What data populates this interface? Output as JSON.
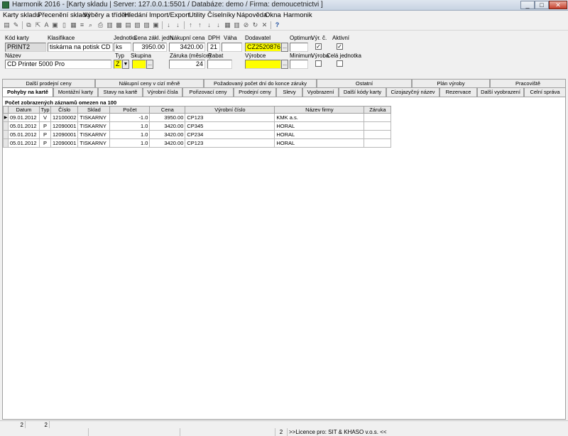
{
  "window": {
    "title": "Harmonik 2016 - [Karty skladu | Server: 127.0.0.1:5501 / Databáze: demo / Firma: demoucetnictvi ]",
    "min": "_",
    "max": "□",
    "close": "✕"
  },
  "menu": [
    "Karty skladu",
    "Přecenění skladu",
    "Výběry a třídění",
    "Hledání",
    "Import/Export",
    "Utility",
    "Číselníky",
    "Nápověda",
    "Okna",
    "Harmonik"
  ],
  "form": {
    "labels": {
      "kod_karty": "Kód karty",
      "klasifikace": "Klasifikace",
      "jednotka": "Jednotka",
      "cena_zakl": "Cena zákl. jedn.",
      "nakupni_cena": "Nákupní cena",
      "dph": "DPH",
      "vaha": "Váha",
      "dodavatel": "Dodavatel",
      "optimum": "Optimum",
      "vyr_c": "Výr. č.",
      "aktivni": "Aktivní",
      "nazev": "Název",
      "typ": "Typ",
      "skupina": "Skupina",
      "zaruka": "Záruka (měsíce)",
      "rabat": "Rabat",
      "vyrobce": "Výrobce",
      "minimum": "Minimum",
      "vyroba": "Výroba",
      "cela_jednotka": "Celá jednotka"
    },
    "values": {
      "kod_karty": "PRINT2",
      "klasifikace": "tiskárna na potisk CD",
      "jednotka": "ks",
      "cena_zakl": "3950.00",
      "nakupni_cena": "3420.00",
      "dph": "21",
      "vaha": "",
      "dodavatel": "CZ25208764",
      "optimum": "",
      "nazev": "CD Printer 5000 Pro",
      "typ": "Z",
      "skupina": "",
      "zaruka": "24",
      "rabat": "",
      "vyrobce": "",
      "minimum": ""
    },
    "checks": {
      "vyr_c": true,
      "aktivni": true,
      "vyroba": false,
      "cela_jednotka": false
    },
    "button_dots": "..."
  },
  "tabs_row1": [
    "Další prodejní ceny",
    "Nákupní ceny v cizí měně",
    "Požadovaný počet dní do konce záruky",
    "Ostatní",
    "Plán výroby",
    "Pracoviště"
  ],
  "tabs_row2": [
    "Pohyby na kartě",
    "Montážní karty",
    "Stavy na kartě",
    "Výrobní čísla",
    "Pořizovací ceny",
    "Prodejní ceny",
    "Slevy",
    "Vyobrazení",
    "Další kódy karty",
    "Cizojazyčný název",
    "Rezervace",
    "Další vyobrazení",
    "Celní správa"
  ],
  "grid": {
    "count_label": "Počet zobrazených záznamů omezen na 100",
    "columns": [
      "Datum",
      "Typ",
      "Číslo",
      "Sklad",
      "Počet",
      "Cena",
      "Výrobní číslo",
      "Název firmy",
      "Záruka"
    ],
    "rows": [
      [
        "09.01.2012",
        "V",
        "12100002",
        "TISKARNY",
        "-1.0",
        "3950.00",
        "CP123",
        "KMK a.s.",
        ""
      ],
      [
        "05.01.2012",
        "P",
        "12090001",
        "TISKARNY",
        "1.0",
        "3420.00",
        "CP345",
        "HORAL",
        ""
      ],
      [
        "05.01.2012",
        "P",
        "12090001",
        "TISKARNY",
        "1.0",
        "3420.00",
        "CP234",
        "HORAL",
        ""
      ],
      [
        "05.01.2012",
        "P",
        "12090001",
        "TISKARNY",
        "1.0",
        "3420.00",
        "CP123",
        "HORAL",
        ""
      ]
    ]
  },
  "status1": {
    "a": "2",
    "b": "2"
  },
  "status2": {
    "a": "2",
    "licence": ">>Licence pro:  SIT & KHASO v.o.s. <<"
  },
  "colors": {
    "highlight": "#ffff00",
    "readonly": "#dcdcdc"
  }
}
